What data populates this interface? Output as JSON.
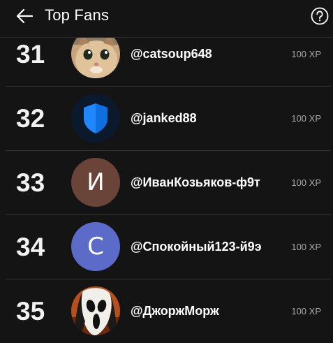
{
  "header": {
    "title": "Top Fans",
    "back_icon": "arrow-left-icon",
    "help_icon": "question-circle-icon"
  },
  "colors": {
    "background": "#141414",
    "divider": "#333333",
    "xp_text": "#a8a8a8"
  },
  "fans": [
    {
      "rank": "31",
      "username": "@catsoup648",
      "xp": "100 XP",
      "avatar": {
        "type": "photo",
        "subject": "kitten"
      }
    },
    {
      "rank": "32",
      "username": "@janked88",
      "xp": "100 XP",
      "avatar": {
        "type": "icon",
        "icon": "blue-shield-icon"
      }
    },
    {
      "rank": "33",
      "username": "@ИванКозьяков-ф9т",
      "xp": "100 XP",
      "avatar": {
        "type": "letter",
        "letter": "И",
        "color": "#6a4438"
      }
    },
    {
      "rank": "34",
      "username": "@Спокойный123-й9э",
      "xp": "100 XP",
      "avatar": {
        "type": "letter",
        "letter": "С",
        "color": "#5c6bc8"
      }
    },
    {
      "rank": "35",
      "username": "@ДжоржМорж",
      "xp": "100 XP",
      "avatar": {
        "type": "photo",
        "subject": "ghostface mask"
      }
    }
  ]
}
